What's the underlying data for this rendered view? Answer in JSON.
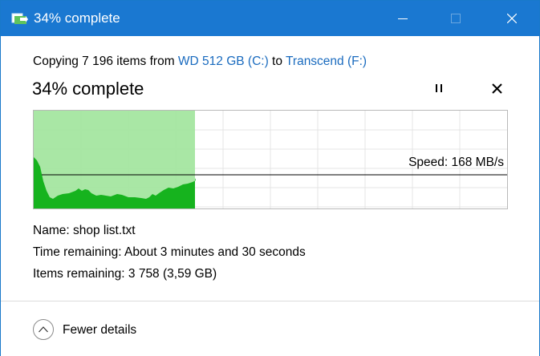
{
  "window": {
    "title": "34% complete",
    "accent_color": "#1a78d1",
    "icons": [
      "file-copy-icon",
      "minimize-icon",
      "maximize-icon",
      "close-icon"
    ]
  },
  "copy": {
    "prefix": "Copying 7 196 items from ",
    "source": "WD 512 GB (C:)",
    "middle": " to ",
    "destination": "Transcend (F:)",
    "link_color": "#1a6bbf"
  },
  "progress": {
    "heading": "34% complete",
    "fraction": 0.34,
    "speed_label": "Speed: 168 MB/s",
    "fill_color": "#a4e6a0",
    "graph_color": "#16b31e",
    "icons": [
      "pause-icon",
      "cancel-icon"
    ]
  },
  "details": {
    "name_label": "Name: ",
    "name_value": "shop list.txt",
    "time_label": "Time remaining: ",
    "time_value": "About 3 minutes and 30 seconds",
    "items_label": "Items remaining: ",
    "items_value": "3 758 (3,59 GB)"
  },
  "footer": {
    "toggle_label": "Fewer details",
    "toggle_icon": "chevron-up-circle-icon"
  }
}
